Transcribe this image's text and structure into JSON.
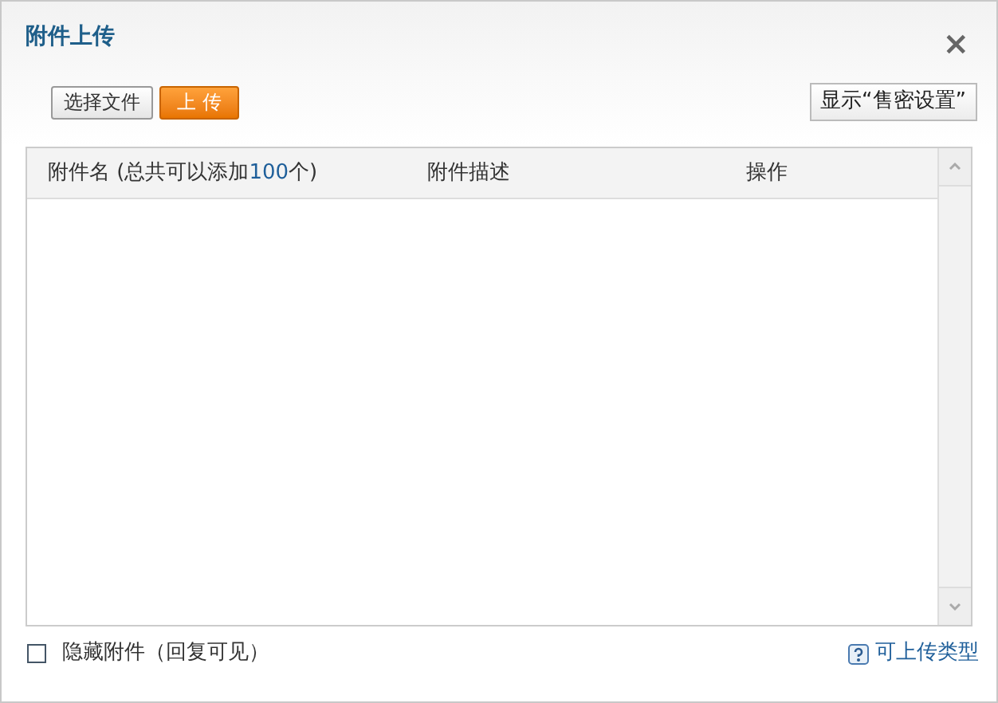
{
  "dialog": {
    "title": "附件上传",
    "close": "×"
  },
  "toolbar": {
    "buttons": [
      {
        "label": "选择文件",
        "kind": "plain"
      },
      {
        "label": "上 传",
        "kind": "primary"
      }
    ],
    "right_button": "显示“售密设置”"
  },
  "table": {
    "columns": [
      {
        "label": "附件名 (总共可以添加**100**个)"
      },
      {
        "label": "附件描述"
      },
      {
        "label": "操作"
      }
    ]
  },
  "footer": {
    "hide_attachments": {
      "label": "隐藏附件（回复可见）",
      "checked": false
    },
    "link": "可上传类型"
  }
}
